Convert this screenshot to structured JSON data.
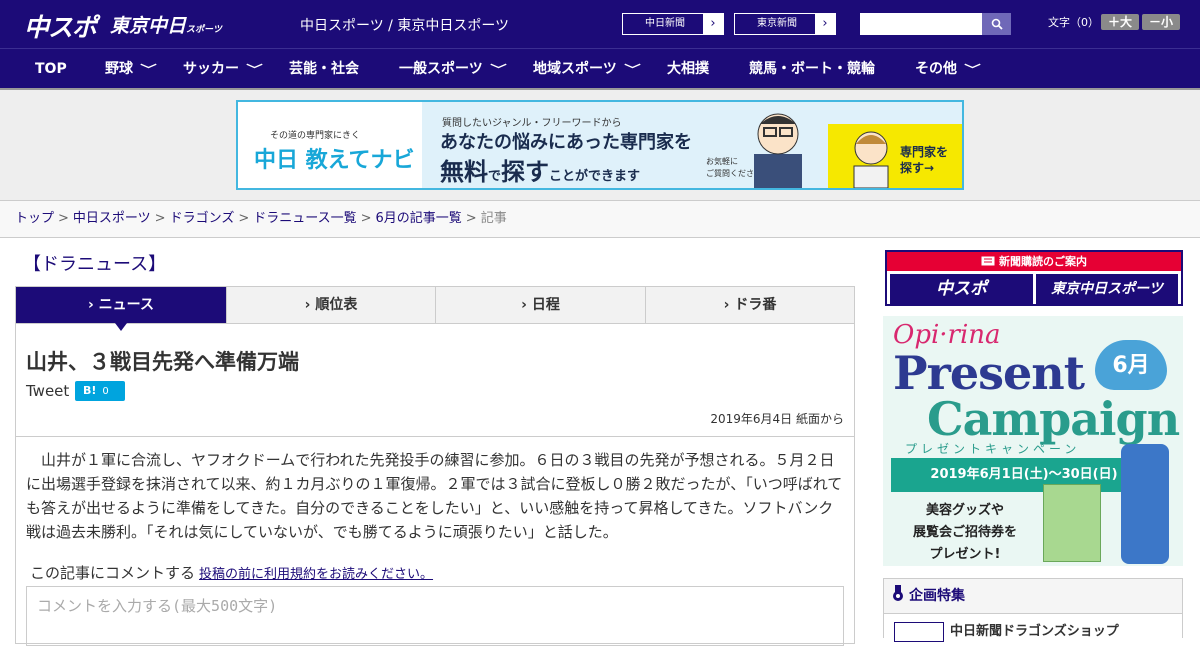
{
  "header": {
    "logo_main": "中スポ",
    "logo_sub": "東京中日",
    "logo_sub_small": "スポーツ",
    "site_title": "中日スポーツ / 東京中日スポーツ",
    "link1": "中日新聞",
    "link2": "東京新聞",
    "arrow": "›",
    "search_icon": "🔍",
    "font_label": "文字（0）",
    "font_plus": "＋大",
    "font_minus": "－小"
  },
  "nav": {
    "items": [
      "TOP",
      "野球",
      "サッカー",
      "芸能・社会",
      "一般スポーツ",
      "地域スポーツ",
      "大相撲",
      "競馬・ボート・競輪",
      "その他"
    ],
    "chev": "﹀"
  },
  "banner": {
    "left_small": "その道の専門家にきく",
    "left_big": "中日 教えてナビ",
    "line1": "質問したいジャンル・フリーワードから",
    "line2": "あなたの悩みにあった専門家を",
    "line3a": "無料",
    "line3b": "で",
    "line3c": "探す",
    "line3d": "ことができます",
    "note1": "お気軽に",
    "note2": "ご質問ください!",
    "cta1": "専門家を",
    "cta2": "探す→"
  },
  "breadcrumb": [
    "トップ",
    "中日スポーツ",
    "ドラゴンズ",
    "ドラニュース一覧",
    "6月の記事一覧",
    "記事"
  ],
  "breadcrumb_sep": ">",
  "section_title": "【ドラニュース】",
  "tabs": [
    "› ニュース",
    "› 順位表",
    "› 日程",
    "› ドラ番"
  ],
  "article": {
    "headline": "山井、３戦目先発へ準備万端",
    "tweet": "Tweet",
    "hatena": "B!",
    "hatena_count": "0",
    "date": "2019年6月4日 紙面から",
    "body": "山井が１軍に合流し、ヤフオクドームで行われた先発投手の練習に参加。６日の３戦目の先発が予想される。５月２日に出場選手登録を抹消されて以来、約１カ月ぶりの１軍復帰。２軍では３試合に登板し０勝２敗だったが、「いつ呼ばれても答えが出せるように準備をしてきた。自分のできることをしたい」と、いい感触を持って昇格してきた。ソフトバンク戦は過去未勝利。「それは気にしていないが、でも勝てるように頑張りたい」と話した。",
    "comment_label": "この記事にコメントする",
    "comment_link": "投稿の前に利用規約をお読みください。",
    "comment_placeholder": "コメントを入力する(最大500文字)"
  },
  "sidebar": {
    "subscribe_header": "新聞購読のご案内",
    "sub1": "中スポ",
    "sub2": "東京中日スポーツ",
    "ad_logo": "Opi·rina",
    "ad_present": "Present",
    "ad_campaign": "Campaign",
    "ad_month": "6月",
    "ad_kana": "プレゼントキャンペーン",
    "ad_dates": "2019年6月1日(土)〜30日(日)",
    "ad_text1": "美容グッズや",
    "ad_text2": "展覧会ご招待券を",
    "ad_text3": "プレゼント!",
    "feature_header": "企画特集",
    "feature_item": "中日新聞ドラゴンズショップ"
  }
}
